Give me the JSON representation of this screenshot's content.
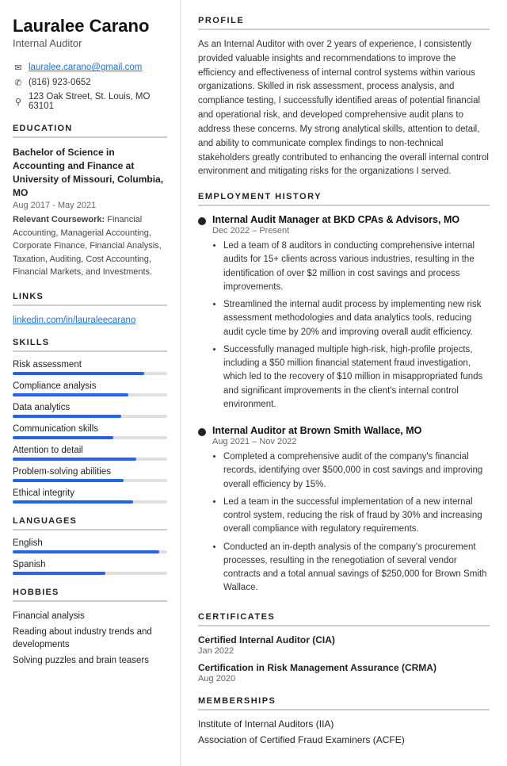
{
  "sidebar": {
    "name": "Lauralee Carano",
    "title": "Internal Auditor",
    "contact": {
      "email": "lauralee.carano@gmail.com",
      "phone": "(816) 923-0652",
      "address": "123 Oak Street, St. Louis, MO 63101"
    },
    "education": {
      "section_title": "EDUCATION",
      "degree": "Bachelor of Science in Accounting and Finance at University of Missouri, Columbia, MO",
      "dates": "Aug 2017 - May 2021",
      "coursework_label": "Relevant Coursework:",
      "coursework": "Financial Accounting, Managerial Accounting, Corporate Finance, Financial Analysis, Taxation, Auditing, Cost Accounting, Financial Markets, and Investments."
    },
    "links": {
      "section_title": "LINKS",
      "linkedin": "linkedin.com/in/lauraleecarano"
    },
    "skills": {
      "section_title": "SKILLS",
      "items": [
        {
          "label": "Risk assessment",
          "pct": 85
        },
        {
          "label": "Compliance analysis",
          "pct": 75
        },
        {
          "label": "Data analytics",
          "pct": 70
        },
        {
          "label": "Communication skills",
          "pct": 65
        },
        {
          "label": "Attention to detail",
          "pct": 80
        },
        {
          "label": "Problem-solving abilities",
          "pct": 72
        },
        {
          "label": "Ethical integrity",
          "pct": 78
        }
      ]
    },
    "languages": {
      "section_title": "LANGUAGES",
      "items": [
        {
          "label": "English",
          "pct": 95
        },
        {
          "label": "Spanish",
          "pct": 60
        }
      ]
    },
    "hobbies": {
      "section_title": "HOBBIES",
      "items": [
        "Financial analysis",
        "Reading about industry trends and developments",
        "Solving puzzles and brain teasers"
      ]
    }
  },
  "main": {
    "profile": {
      "section_title": "PROFILE",
      "text": "As an Internal Auditor with over 2 years of experience, I consistently provided valuable insights and recommendations to improve the efficiency and effectiveness of internal control systems within various organizations. Skilled in risk assessment, process analysis, and compliance testing, I successfully identified areas of potential financial and operational risk, and developed comprehensive audit plans to address these concerns. My strong analytical skills, attention to detail, and ability to communicate complex findings to non-technical stakeholders greatly contributed to enhancing the overall internal control environment and mitigating risks for the organizations I served."
    },
    "employment": {
      "section_title": "EMPLOYMENT HISTORY",
      "jobs": [
        {
          "title": "Internal Audit Manager at BKD CPAs & Advisors, MO",
          "dates": "Dec 2022 – Present",
          "bullets": [
            "Led a team of 8 auditors in conducting comprehensive internal audits for 15+ clients across various industries, resulting in the identification of over $2 million in cost savings and process improvements.",
            "Streamlined the internal audit process by implementing new risk assessment methodologies and data analytics tools, reducing audit cycle time by 20% and improving overall audit efficiency.",
            "Successfully managed multiple high-risk, high-profile projects, including a $50 million financial statement fraud investigation, which led to the recovery of $10 million in misappropriated funds and significant improvements in the client's internal control environment."
          ]
        },
        {
          "title": "Internal Auditor at Brown Smith Wallace, MO",
          "dates": "Aug 2021 – Nov 2022",
          "bullets": [
            "Completed a comprehensive audit of the company's financial records, identifying over $500,000 in cost savings and improving overall efficiency by 15%.",
            "Led a team in the successful implementation of a new internal control system, reducing the risk of fraud by 30% and increasing overall compliance with regulatory requirements.",
            "Conducted an in-depth analysis of the company's procurement processes, resulting in the renegotiation of several vendor contracts and a total annual savings of $250,000 for Brown Smith Wallace."
          ]
        }
      ]
    },
    "certificates": {
      "section_title": "CERTIFICATES",
      "items": [
        {
          "name": "Certified Internal Auditor (CIA)",
          "date": "Jan 2022"
        },
        {
          "name": "Certification in Risk Management Assurance (CRMA)",
          "date": "Aug 2020"
        }
      ]
    },
    "memberships": {
      "section_title": "MEMBERSHIPS",
      "items": [
        "Institute of Internal Auditors (IIA)",
        "Association of Certified Fraud Examiners (ACFE)"
      ]
    }
  }
}
